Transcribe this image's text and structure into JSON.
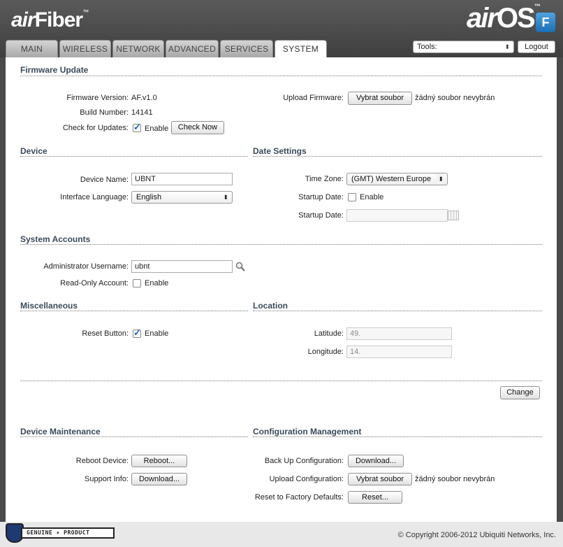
{
  "header": {
    "brand_left_air": "air",
    "brand_left_rest": "Fiber",
    "brand_left_tm": "™",
    "brand_right_air": "air",
    "brand_right_rest": "OS",
    "brand_right_tm": "™",
    "badge": "F"
  },
  "tabs": [
    {
      "label": "MAIN"
    },
    {
      "label": "WIRELESS"
    },
    {
      "label": "NETWORK"
    },
    {
      "label": "ADVANCED"
    },
    {
      "label": "SERVICES"
    },
    {
      "label": "SYSTEM",
      "active": true
    }
  ],
  "tools": {
    "selected": "Tools:",
    "logout_label": "Logout"
  },
  "firmware": {
    "title": "Firmware Update",
    "version_label": "Firmware Version:",
    "version_value": "AF.v1.0",
    "build_label": "Build Number:",
    "build_value": "14141",
    "check_label": "Check for Updates:",
    "check_enabled": true,
    "enable_text": "Enable",
    "check_now_label": "Check Now",
    "upload_label": "Upload Firmware:",
    "choose_file_label": "Vybrat soubor",
    "no_file_text": "žádný soubor nevybrán"
  },
  "device": {
    "title": "Device",
    "name_label": "Device Name:",
    "name_value": "UBNT",
    "language_label": "Interface Language:",
    "language_value": "English"
  },
  "date_settings": {
    "title": "Date Settings",
    "timezone_label": "Time Zone:",
    "timezone_value": "(GMT) Western Europe",
    "startup_enable_label": "Startup Date:",
    "startup_enabled": false,
    "enable_text": "Enable",
    "startup_date_label": "Startup Date:",
    "startup_date_value": ""
  },
  "accounts": {
    "title": "System Accounts",
    "admin_label": "Administrator Username:",
    "admin_value": "ubnt",
    "readonly_label": "Read-Only Account:",
    "readonly_enabled": false,
    "enable_text": "Enable"
  },
  "misc": {
    "title": "Miscellaneous",
    "reset_label": "Reset Button:",
    "reset_enabled": true,
    "enable_text": "Enable"
  },
  "location": {
    "title": "Location",
    "latitude_label": "Latitude:",
    "latitude_value": "49.",
    "longitude_label": "Longitude:",
    "longitude_value": "14."
  },
  "change_label": "Change",
  "maintenance": {
    "title": "Device Maintenance",
    "reboot_label": "Reboot Device:",
    "reboot_button": "Reboot...",
    "support_label": "Support Info:",
    "support_button": "Download..."
  },
  "config": {
    "title": "Configuration Management",
    "backup_label": "Back Up Configuration:",
    "backup_button": "Download...",
    "upload_label": "Upload Configuration:",
    "choose_file_label": "Vybrat soubor",
    "no_file_text": "žádný soubor nevybrán",
    "reset_label": "Reset to Factory Defaults:",
    "reset_button": "Reset..."
  },
  "footer": {
    "genuine_text": "GENUINE ✶ PRODUCT",
    "copyright": "© Copyright 2006-2012 Ubiquiti Networks, Inc."
  }
}
